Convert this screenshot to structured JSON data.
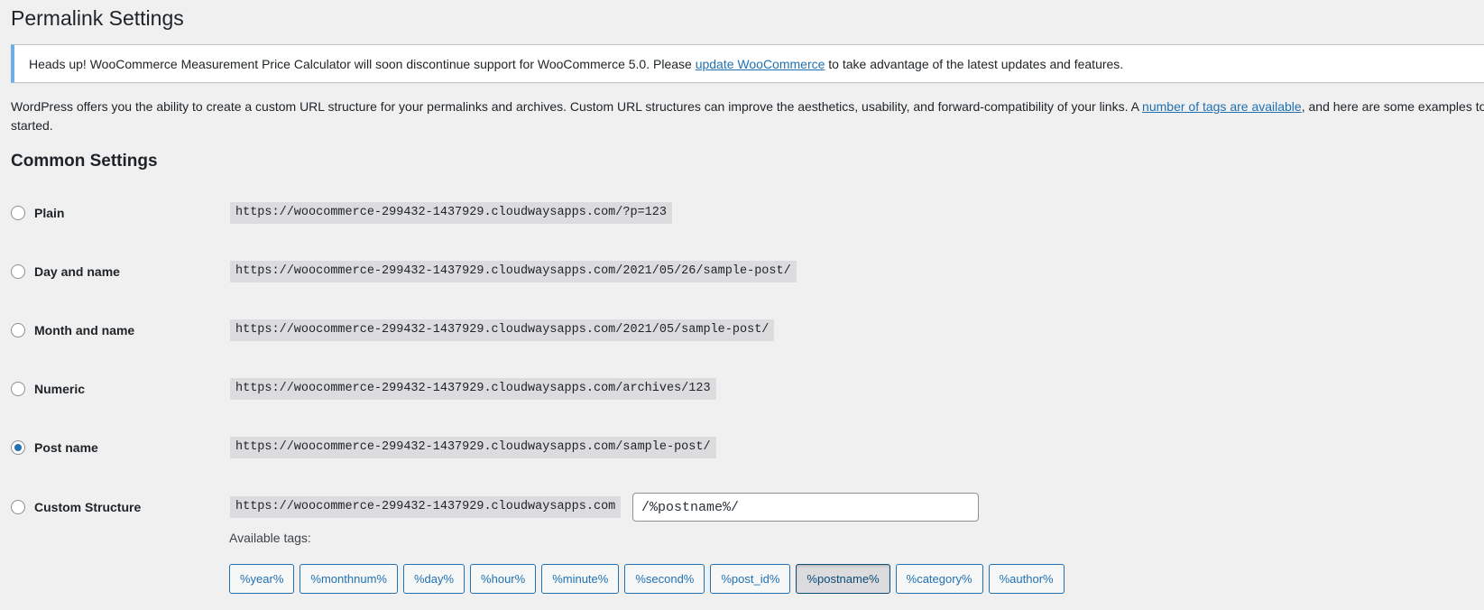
{
  "page": {
    "title": "Permalink Settings"
  },
  "notice": {
    "text_before": "Heads up! WooCommerce Measurement Price Calculator will soon discontinue support for WooCommerce 5.0. Please ",
    "link_text": "update WooCommerce",
    "text_after": " to take advantage of the latest updates and features.",
    "accent_color": "#72aee6"
  },
  "intro": {
    "line1_before": "WordPress offers you the ability to create a custom URL structure for your permalinks and archives. Custom URL structures can improve the aesthetics, usability, and forward-compatibility of your links. A ",
    "line1_link": "number of tags are available",
    "line1_after": ", and here are some examples to g",
    "line2": "started."
  },
  "common_settings": {
    "heading": "Common Settings",
    "options": [
      {
        "label": "Plain",
        "url": "https://woocommerce-299432-1437929.cloudwaysapps.com/?p=123",
        "checked": false
      },
      {
        "label": "Day and name",
        "url": "https://woocommerce-299432-1437929.cloudwaysapps.com/2021/05/26/sample-post/",
        "checked": false
      },
      {
        "label": "Month and name",
        "url": "https://woocommerce-299432-1437929.cloudwaysapps.com/2021/05/sample-post/",
        "checked": false
      },
      {
        "label": "Numeric",
        "url": "https://woocommerce-299432-1437929.cloudwaysapps.com/archives/123",
        "checked": false
      },
      {
        "label": "Post name",
        "url": "https://woocommerce-299432-1437929.cloudwaysapps.com/sample-post/",
        "checked": true
      },
      {
        "label": "Custom Structure",
        "url": "https://woocommerce-299432-1437929.cloudwaysapps.com",
        "checked": false
      }
    ],
    "custom_structure_value": "/%postname%/"
  },
  "available_tags": {
    "label": "Available tags:",
    "tags": [
      "%year%",
      "%monthnum%",
      "%day%",
      "%hour%",
      "%minute%",
      "%second%",
      "%post_id%",
      "%postname%",
      "%category%",
      "%author%"
    ],
    "active_tag": "%postname%"
  },
  "colors": {
    "link": "#2271b1",
    "radio_checked": "#2271b1",
    "background": "#f0f0f1"
  }
}
